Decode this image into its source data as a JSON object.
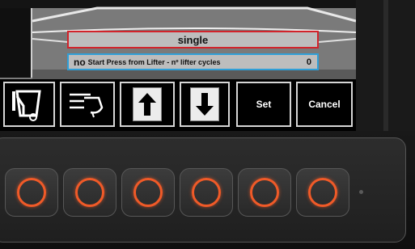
{
  "screen": {
    "mode_value": "single",
    "parameter_flag": "no",
    "parameter_label": "Start Press from Lifter - nº lifter cycles",
    "parameter_value": "0"
  },
  "softkeys": {
    "set_label": "Set",
    "cancel_label": "Cancel",
    "icons": [
      "lifter-tilt-icon",
      "lifter-arm-icon",
      "arrow-up-icon",
      "arrow-down-icon"
    ]
  },
  "hardware_keys": {
    "count": 6,
    "ring_color": "#f05a28",
    "icon": "circle-ring-icon"
  },
  "colors": {
    "field_top_border": "#d2232a",
    "field_bottom_border": "#2f9fd8",
    "screen_background": "#7d7d7d"
  }
}
